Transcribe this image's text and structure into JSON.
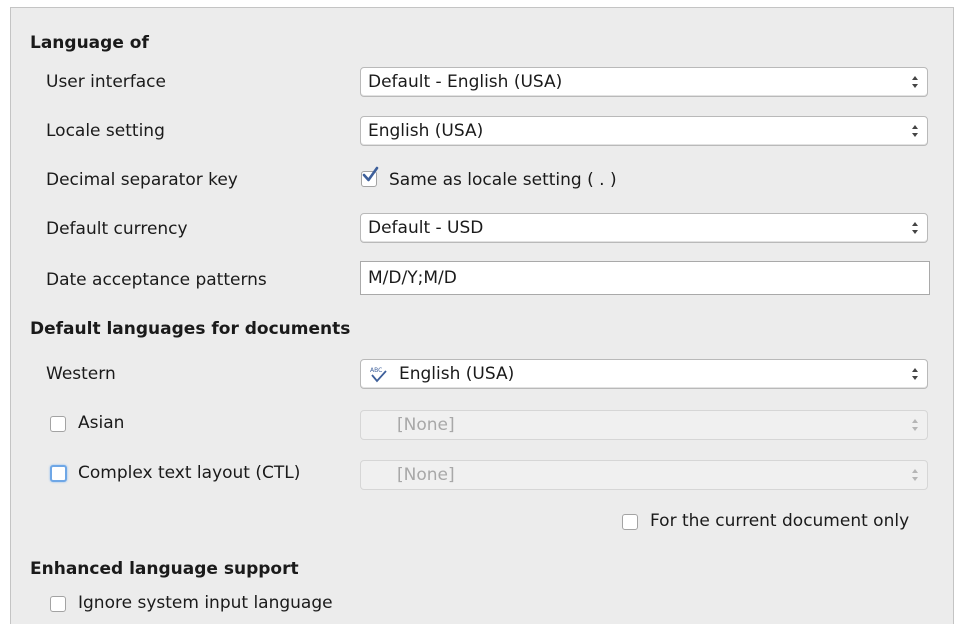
{
  "language_of": {
    "heading": "Language of",
    "user_interface": {
      "label": "User interface",
      "value": "Default - English (USA)"
    },
    "locale_setting": {
      "label": "Locale setting",
      "value": "English (USA)"
    },
    "decimal_separator": {
      "label": "Decimal separator key",
      "checkbox_label": "Same as locale setting ( . )",
      "checked": true
    },
    "default_currency": {
      "label": "Default currency",
      "value": "Default - USD"
    },
    "date_patterns": {
      "label": "Date acceptance patterns",
      "value": "M/D/Y;M/D"
    }
  },
  "default_languages": {
    "heading": "Default languages for documents",
    "western": {
      "label": "Western",
      "value": "English (USA)",
      "icon": "spellcheck-icon"
    },
    "asian": {
      "label": "Asian",
      "value": "[None]",
      "checked": false
    },
    "ctl": {
      "label": "Complex text layout (CTL)",
      "value": "[None]",
      "checked": false
    },
    "current_doc_only": {
      "label": "For the current document only",
      "checked": false
    }
  },
  "enhanced": {
    "heading": "Enhanced language support",
    "ignore_input": {
      "label": "Ignore system input language",
      "checked": false
    }
  },
  "colors": {
    "panel_bg": "#ececec",
    "focus_ring": "#6fa7e6",
    "checkmark": "#3d5f9a"
  }
}
